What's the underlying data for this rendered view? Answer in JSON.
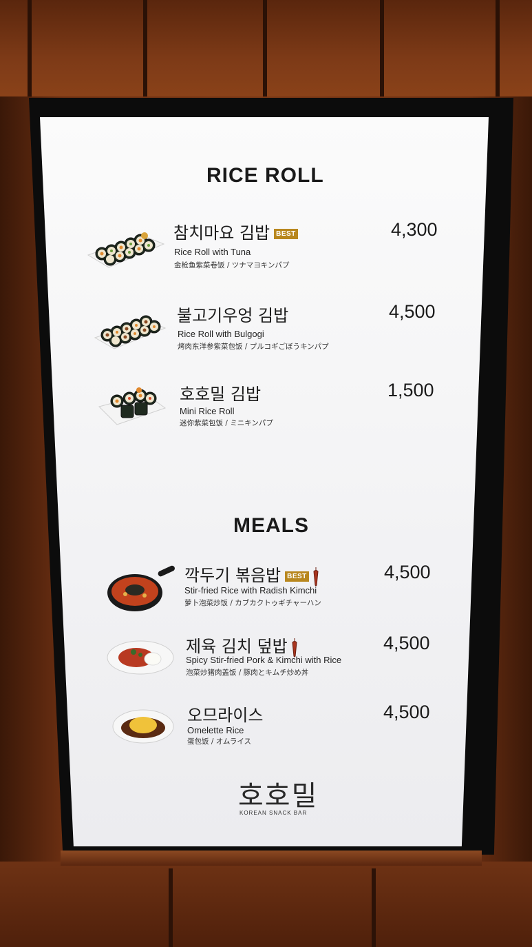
{
  "sections": {
    "rice_roll": {
      "title": "RICE ROLL",
      "items": [
        {
          "name_ko": "참치마요 김밥",
          "badge": "BEST",
          "name_en": "Rice Roll with Tuna",
          "sub": "金枪鱼紫菜卷饭 / ツナマヨキンパプ",
          "price": "4,300"
        },
        {
          "name_ko": "불고기우엉 김밥",
          "name_en": "Rice Roll with Bulgogi",
          "sub": "烤肉东洋参紫菜包饭 / プルコギごぼうキンパプ",
          "price": "4,500"
        },
        {
          "name_ko": "호호밀 김밥",
          "name_en": "Mini Rice Roll",
          "sub": "迷你紫菜包饭 / ミニキンパプ",
          "price": "1,500"
        }
      ]
    },
    "meals": {
      "title": "MEALS",
      "items": [
        {
          "name_ko": "깍두기 볶음밥",
          "badge": "BEST",
          "spicy": true,
          "name_en": "Stir-fried Rice with Radish Kimchi",
          "sub": "萝卜泡菜炒饭 / カブカクトゥギチャーハン",
          "price": "4,500"
        },
        {
          "name_ko": "제육 김치 덮밥",
          "spicy": true,
          "name_en": "Spicy Stir-fried Pork & Kimchi with Rice",
          "sub": "泡菜炒猪肉盖饭 / 豚肉とキムチ炒め丼",
          "price": "4,500"
        },
        {
          "name_ko": "오므라이스",
          "name_en": "Omelette Rice",
          "sub": "蛋包饭 / オムライス",
          "price": "4,500"
        }
      ]
    }
  },
  "brand": {
    "name_ko": "호호밀",
    "tagline": "KOREAN SNACK BAR"
  },
  "colors": {
    "badge": "#b8871e",
    "chili": "#a8351f",
    "screen": "#f6f6f6",
    "wood": "#7a3816"
  }
}
